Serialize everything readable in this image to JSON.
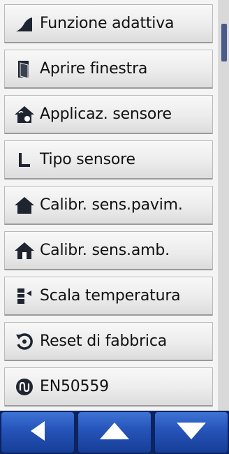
{
  "menu": {
    "items": [
      {
        "label": "Funzione adattiva",
        "icon": "adaptive-ramp-icon"
      },
      {
        "label": "Aprire finestra",
        "icon": "open-window-icon"
      },
      {
        "label": "Applicaz. sensore",
        "icon": "house-sensor-icon"
      },
      {
        "label": "Tipo sensore",
        "icon": "sensor-type-icon"
      },
      {
        "label": "Calibr. sens.pavim.",
        "icon": "house-floor-icon"
      },
      {
        "label": "Calibr. sens.amb.",
        "icon": "house-room-icon"
      },
      {
        "label": "Scala temperatura",
        "icon": "temperature-scale-icon"
      },
      {
        "label": "Reset di fabbrica",
        "icon": "reset-icon"
      },
      {
        "label": "EN50559",
        "icon": "en50559-icon"
      }
    ]
  },
  "nav": {
    "back": "back-arrow-icon",
    "up": "up-arrow-icon",
    "down": "down-arrow-icon"
  },
  "colors": {
    "nav_blue": "#2553b8",
    "icon_dark": "#1e2430",
    "scroll_thumb": "#4a5a8a"
  }
}
